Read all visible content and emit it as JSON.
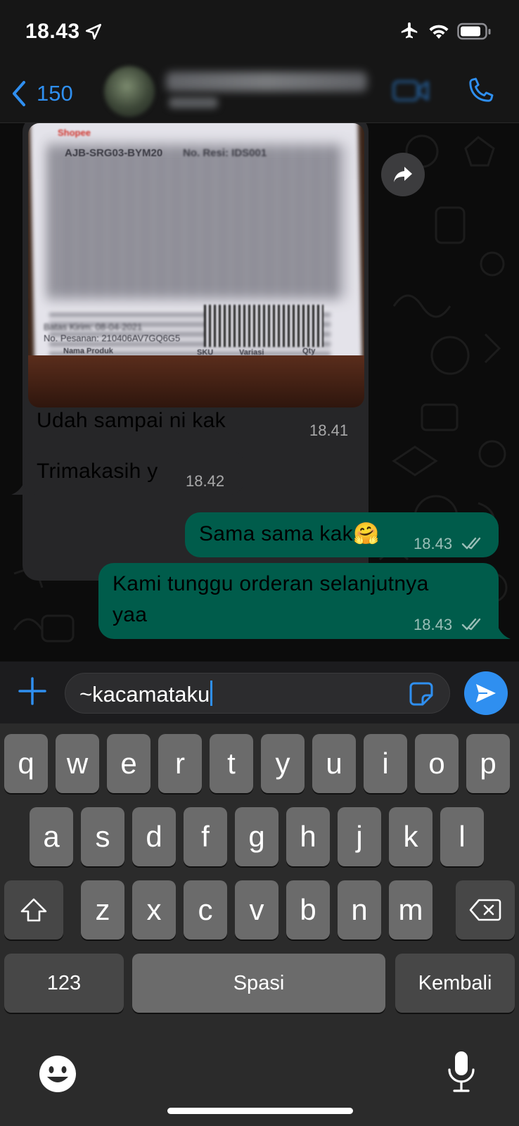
{
  "status_bar": {
    "time": "18.43"
  },
  "header": {
    "back_count": "150"
  },
  "messages": [
    {
      "id": "m1",
      "direction": "incoming",
      "type": "image",
      "caption": "Udah sampai ni kak",
      "time": "18.41"
    },
    {
      "id": "m2",
      "direction": "incoming",
      "type": "text",
      "text": "Trimakasih y",
      "time": "18.42"
    },
    {
      "id": "m3",
      "direction": "outgoing",
      "type": "text",
      "text": "Sama sama kak🤗",
      "time": "18.43"
    },
    {
      "id": "m4",
      "direction": "outgoing",
      "type": "text",
      "text_line1": "Kami tunggu orderan selanjutnya",
      "text_line2": "yaa",
      "time": "18.43"
    }
  ],
  "photo_text": {
    "shop": "Shopee",
    "code": "AJB-SRG03-BYM20",
    "resi": "No. Resi: IDS001",
    "batas": "Batas Kirim: 08-04-2021",
    "pesanan": "No. Pesanan: 210406AV7GQ6G5",
    "col1": "Nama Produk",
    "col2": "SKU",
    "col3": "Variasi",
    "col4": "Qty"
  },
  "composer": {
    "value": "~kacamataku"
  },
  "keyboard": {
    "row1": [
      "q",
      "w",
      "e",
      "r",
      "t",
      "y",
      "u",
      "i",
      "o",
      "p"
    ],
    "row2": [
      "a",
      "s",
      "d",
      "f",
      "g",
      "h",
      "j",
      "k",
      "l"
    ],
    "row3": [
      "z",
      "x",
      "c",
      "v",
      "b",
      "n",
      "m"
    ],
    "numbers_label": "123",
    "space_label": "Spasi",
    "return_label": "Kembali"
  },
  "colors": {
    "accent": "#2f8ff0",
    "outgoing_bubble": "#005c4b",
    "incoming_bubble": "#262628"
  },
  "icons": {
    "back": "chevron-left-icon",
    "video": "video-call-icon",
    "call": "phone-icon",
    "forward": "forward-icon",
    "attach": "plus-icon",
    "sticker": "sticker-icon",
    "send": "send-icon",
    "shift": "shift-icon",
    "backspace": "backspace-icon",
    "emoji": "emoji-icon",
    "mic": "microphone-icon"
  }
}
